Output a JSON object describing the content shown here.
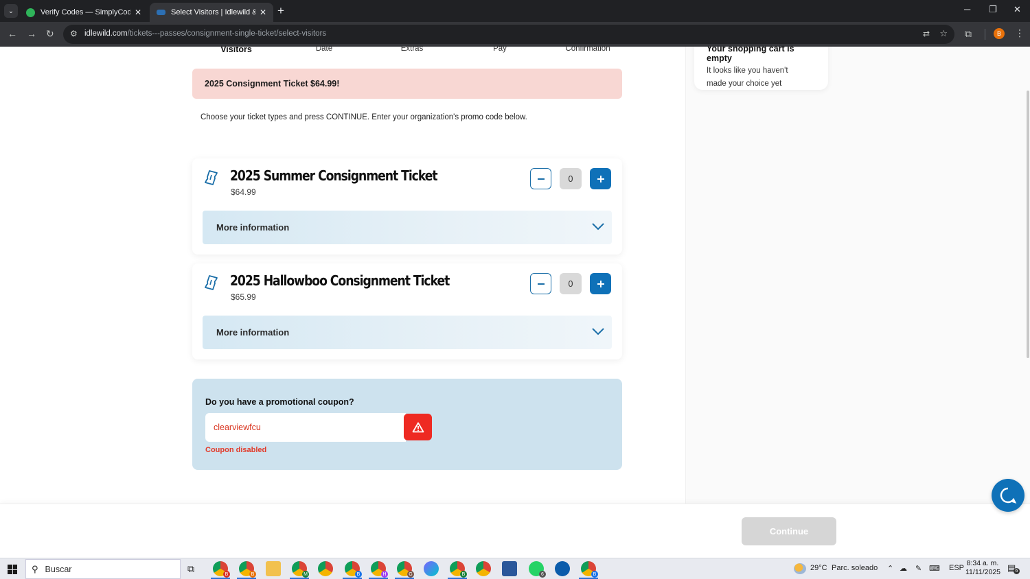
{
  "browser": {
    "tabs": [
      {
        "title": "Verify Codes — SimplyCodes",
        "active": false
      },
      {
        "title": "Select Visitors | Idlewild & Soak",
        "active": true
      }
    ],
    "url_host": "idlewild.com",
    "url_path": "/tickets---passes/consignment-single-ticket/select-visitors",
    "profile_initial": "B"
  },
  "steps": [
    "Visitors",
    "Date",
    "Extras",
    "Pay",
    "Confirmation"
  ],
  "cart": {
    "title": "Your shopping cart is empty",
    "message": "It looks like you haven't made your choice yet"
  },
  "banner": "2025 Consignment Ticket $64.99!",
  "intro": "Choose your ticket types and press CONTINUE. Enter your organization's promo code below.",
  "tickets": [
    {
      "name": "2025 Summer Consignment Ticket",
      "price": "$64.99",
      "quantity": "0",
      "more_label": "More information"
    },
    {
      "name": "2025 Hallowboo Consignment Ticket",
      "price": "$65.99",
      "quantity": "0",
      "more_label": "More information"
    }
  ],
  "promo": {
    "label": "Do you have a promotional coupon?",
    "value": "clearviewfcu",
    "error": "Coupon disabled"
  },
  "continue_label": "Continue",
  "colors": {
    "accent": "#0f71b8",
    "banner": "#f8d7d3",
    "promo_bg": "#cde2ee",
    "error": "#ee2a22"
  },
  "taskbar": {
    "search_placeholder": "Buscar",
    "weather": "29°C",
    "weather_text": "Parc. soleado",
    "language": "ESP",
    "time": "8:34 a. m.",
    "date": "11/11/2025",
    "whatsapp_badge": "6",
    "notification_badge": "6"
  }
}
